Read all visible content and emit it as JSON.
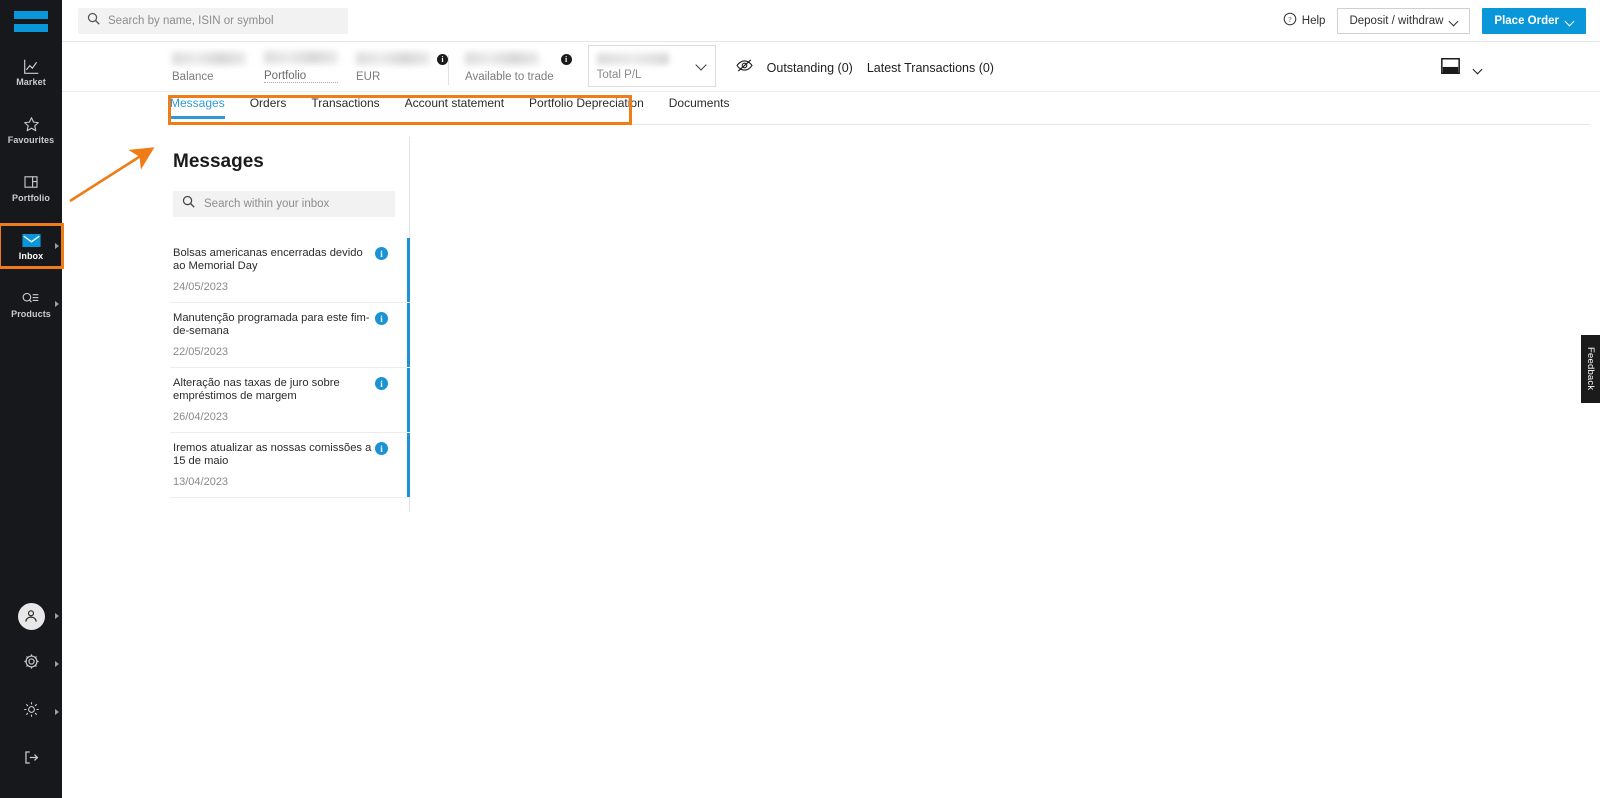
{
  "brand": {
    "logo_name": "equals-logo",
    "accent": "#0a97d9",
    "highlight": "#f07c17"
  },
  "topbar": {
    "search_placeholder": "Search by name, ISIN or symbol",
    "search_value": "",
    "help_label": "Help",
    "deposit_label": "Deposit / withdraw",
    "place_order_label": "Place Order"
  },
  "account": {
    "balance_label": "Balance",
    "portfolio_label": "Portfolio",
    "currency_label": "EUR",
    "available_label": "Available to trade",
    "pl_label": "Total P/L",
    "outstanding_label": "Outstanding (0)",
    "latest_transactions_label": "Latest Transactions (0)"
  },
  "tabs": [
    {
      "label": "Messages",
      "active": true
    },
    {
      "label": "Orders",
      "active": false
    },
    {
      "label": "Transactions",
      "active": false
    },
    {
      "label": "Account statement",
      "active": false
    },
    {
      "label": "Portfolio Depreciation",
      "active": false
    },
    {
      "label": "Documents",
      "active": false
    }
  ],
  "sidebar": {
    "items": [
      {
        "label": "Market",
        "icon": "chart-line-icon",
        "active": false,
        "expandable": false
      },
      {
        "label": "Favourites",
        "icon": "star-icon",
        "active": false,
        "expandable": false
      },
      {
        "label": "Portfolio",
        "icon": "portfolio-icon",
        "active": false,
        "expandable": false
      },
      {
        "label": "Inbox",
        "icon": "envelope-icon",
        "active": true,
        "expandable": true
      },
      {
        "label": "Products",
        "icon": "products-icon",
        "active": false,
        "expandable": true
      }
    ],
    "bottom": [
      {
        "name": "avatar",
        "icon": "user-icon",
        "expandable": true
      },
      {
        "name": "settings",
        "icon": "gear-icon",
        "expandable": true
      },
      {
        "name": "theme",
        "icon": "brightness-icon",
        "expandable": true
      },
      {
        "name": "logout",
        "icon": "logout-icon",
        "expandable": false
      }
    ]
  },
  "messages_panel": {
    "title": "Messages",
    "search_placeholder": "Search within your inbox",
    "search_value": "",
    "items": [
      {
        "subject": "Bolsas americanas encerradas devido ao Memorial Day",
        "date": "24/05/2023",
        "unread": true
      },
      {
        "subject": "Manutenção programada para este fim-de-semana",
        "date": "22/05/2023",
        "unread": true
      },
      {
        "subject": "Alteração nas taxas de juro sobre empréstimos de margem",
        "date": "26/04/2023",
        "unread": true
      },
      {
        "subject": "Iremos atualizar as nossas comissões a 15 de maio",
        "date": "13/04/2023",
        "unread": true
      }
    ]
  },
  "feedback": {
    "label": "Feedback"
  }
}
